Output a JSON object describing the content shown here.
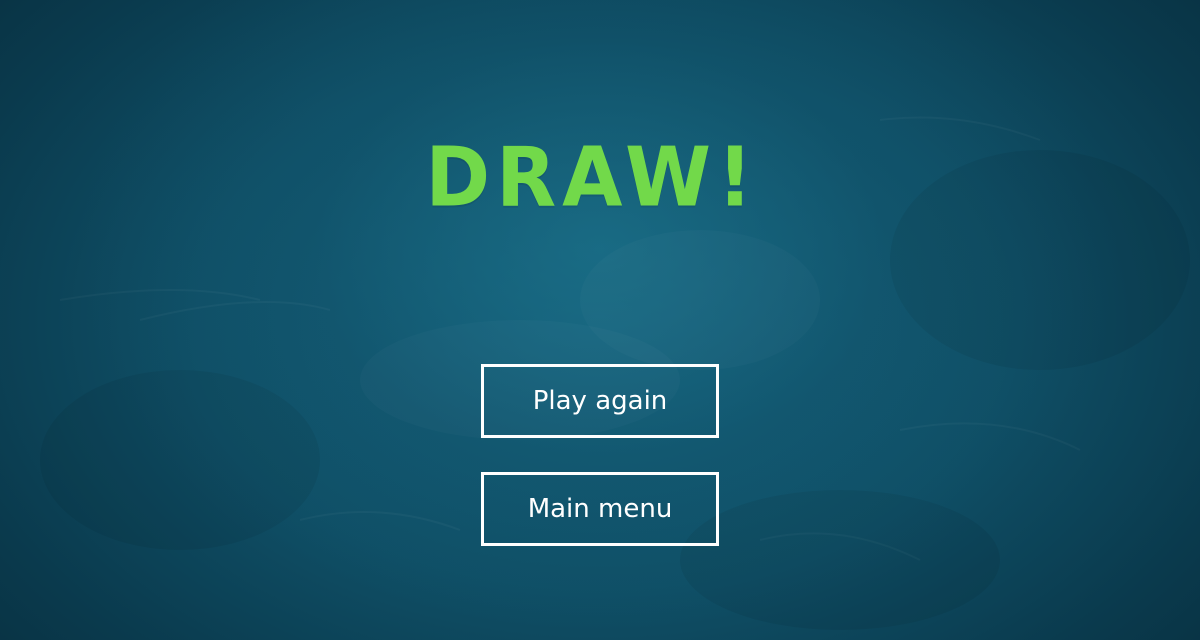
{
  "screen": {
    "title": "DRAW!",
    "title_color": "#72d94a",
    "background_color": "#0f4f66"
  },
  "menu": {
    "play_again_label": "Play again",
    "main_menu_label": "Main menu"
  }
}
